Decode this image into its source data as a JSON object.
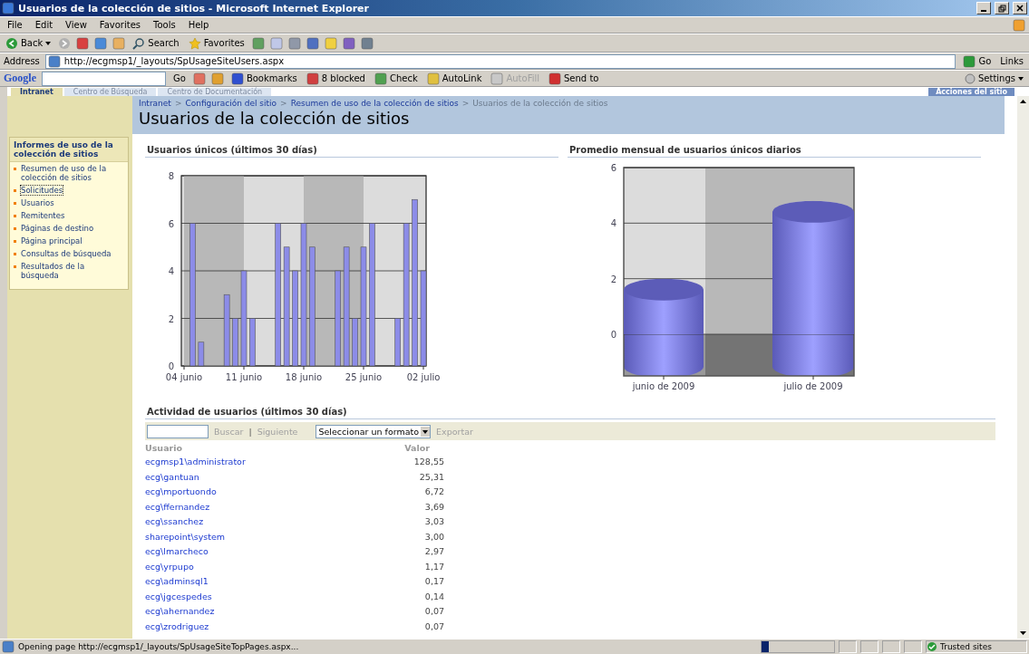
{
  "window": {
    "title": "Usuarios de la colección de sitios - Microsoft Internet Explorer"
  },
  "menu": [
    "File",
    "Edit",
    "View",
    "Favorites",
    "Tools",
    "Help"
  ],
  "toolbar": {
    "back": "Back",
    "search": "Search",
    "favorites": "Favorites"
  },
  "address_bar": {
    "label": "Address",
    "url": "http://ecgmsp1/_layouts/SpUsageSiteUsers.aspx",
    "go": "Go",
    "links": "Links"
  },
  "google_bar": {
    "logo": "Google",
    "go": "Go",
    "buttons": [
      {
        "label": "Bookmarks",
        "disabled": false
      },
      {
        "label": "8 blocked",
        "disabled": false
      },
      {
        "label": "Check",
        "disabled": false
      },
      {
        "label": "AutoLink",
        "disabled": false
      },
      {
        "label": "AutoFill",
        "disabled": true
      },
      {
        "label": "Send to",
        "disabled": false
      }
    ],
    "settings": "Settings"
  },
  "site_tabs": [
    {
      "label": "Intranet",
      "selected": true
    },
    {
      "label": "Centro de Búsqueda",
      "selected": false
    },
    {
      "label": "Centro de Documentación",
      "selected": false
    }
  ],
  "site_actions": "Acciones del sitio",
  "breadcrumb": {
    "separator": ">",
    "items": [
      "Intranet",
      "Configuración del sitio",
      "Resumen de uso de la colección de sitios",
      "Usuarios de la colección de sitios"
    ]
  },
  "page_title": "Usuarios de la colección de sitios",
  "sidebar": {
    "title": "Informes de uso de la colección de sitios",
    "items": [
      {
        "label": "Resumen de uso de la colección de sitios",
        "focused": false
      },
      {
        "label": "Solicitudes",
        "focused": true
      },
      {
        "label": "Usuarios",
        "focused": false
      },
      {
        "label": "Remitentes",
        "focused": false
      },
      {
        "label": "Páginas de destino",
        "focused": false
      },
      {
        "label": "Página principal",
        "focused": false
      },
      {
        "label": "Consultas de búsqueda",
        "focused": false
      },
      {
        "label": "Resultados de la búsqueda",
        "focused": false
      }
    ]
  },
  "charts": [
    {
      "title": "Usuarios únicos (últimos 30 días)",
      "chart_data": {
        "type": "bar",
        "categories": [
          "04 junio",
          null,
          null,
          null,
          null,
          null,
          null,
          "11 junio",
          null,
          null,
          null,
          null,
          null,
          null,
          "18 junio",
          null,
          null,
          null,
          null,
          null,
          null,
          "25 junio",
          null,
          null,
          null,
          null,
          null,
          null,
          "02 julio"
        ],
        "values": [
          0,
          6,
          1,
          0,
          0,
          3,
          2,
          4,
          2,
          0,
          0,
          6,
          5,
          4,
          6,
          5,
          0,
          0,
          4,
          5,
          2,
          5,
          6,
          0,
          0,
          2,
          6,
          7,
          4
        ],
        "ylim": [
          0,
          8
        ],
        "yticks": [
          0,
          2,
          4,
          6,
          8
        ],
        "grid": true
      }
    },
    {
      "title": "Promedio mensual de usuarios únicos diarios",
      "chart_data": {
        "type": "bar",
        "categories": [
          "junio de 2009",
          "julio de 2009"
        ],
        "values": [
          2,
          4.8
        ],
        "ylim": [
          -1.5,
          6
        ],
        "yticks": [
          0,
          2,
          4,
          6
        ],
        "grid": true
      }
    }
  ],
  "activity": {
    "title": "Actividad de usuarios (últimos 30 días)",
    "search_button": "Buscar",
    "separator": "|",
    "next_button": "Siguiente",
    "format_select": "Seleccionar un formato",
    "export": "Exportar",
    "columns": [
      "Usuario",
      "Valor"
    ],
    "rows": [
      {
        "user": "ecgmsp1\\administrator",
        "value": "128,55"
      },
      {
        "user": "ecg\\gantuan",
        "value": "25,31"
      },
      {
        "user": "ecg\\mportuondo",
        "value": "6,72"
      },
      {
        "user": "ecg\\ffernandez",
        "value": "3,69"
      },
      {
        "user": "ecg\\ssanchez",
        "value": "3,03"
      },
      {
        "user": "sharepoint\\system",
        "value": "3,00"
      },
      {
        "user": "ecg\\lmarcheco",
        "value": "2,97"
      },
      {
        "user": "ecg\\yrpupo",
        "value": "1,17"
      },
      {
        "user": "ecg\\adminsql1",
        "value": "0,17"
      },
      {
        "user": "ecg\\jgcespedes",
        "value": "0,14"
      },
      {
        "user": "ecg\\ahernandez",
        "value": "0,07"
      },
      {
        "user": "ecg\\zrodriguez",
        "value": "0,07"
      }
    ]
  },
  "status_bar": {
    "text": "Opening page http://ecgmsp1/_layouts/SpUsageSiteTopPages.aspx...",
    "progress": {
      "level": 0.1
    },
    "zone": "Trusted sites"
  }
}
